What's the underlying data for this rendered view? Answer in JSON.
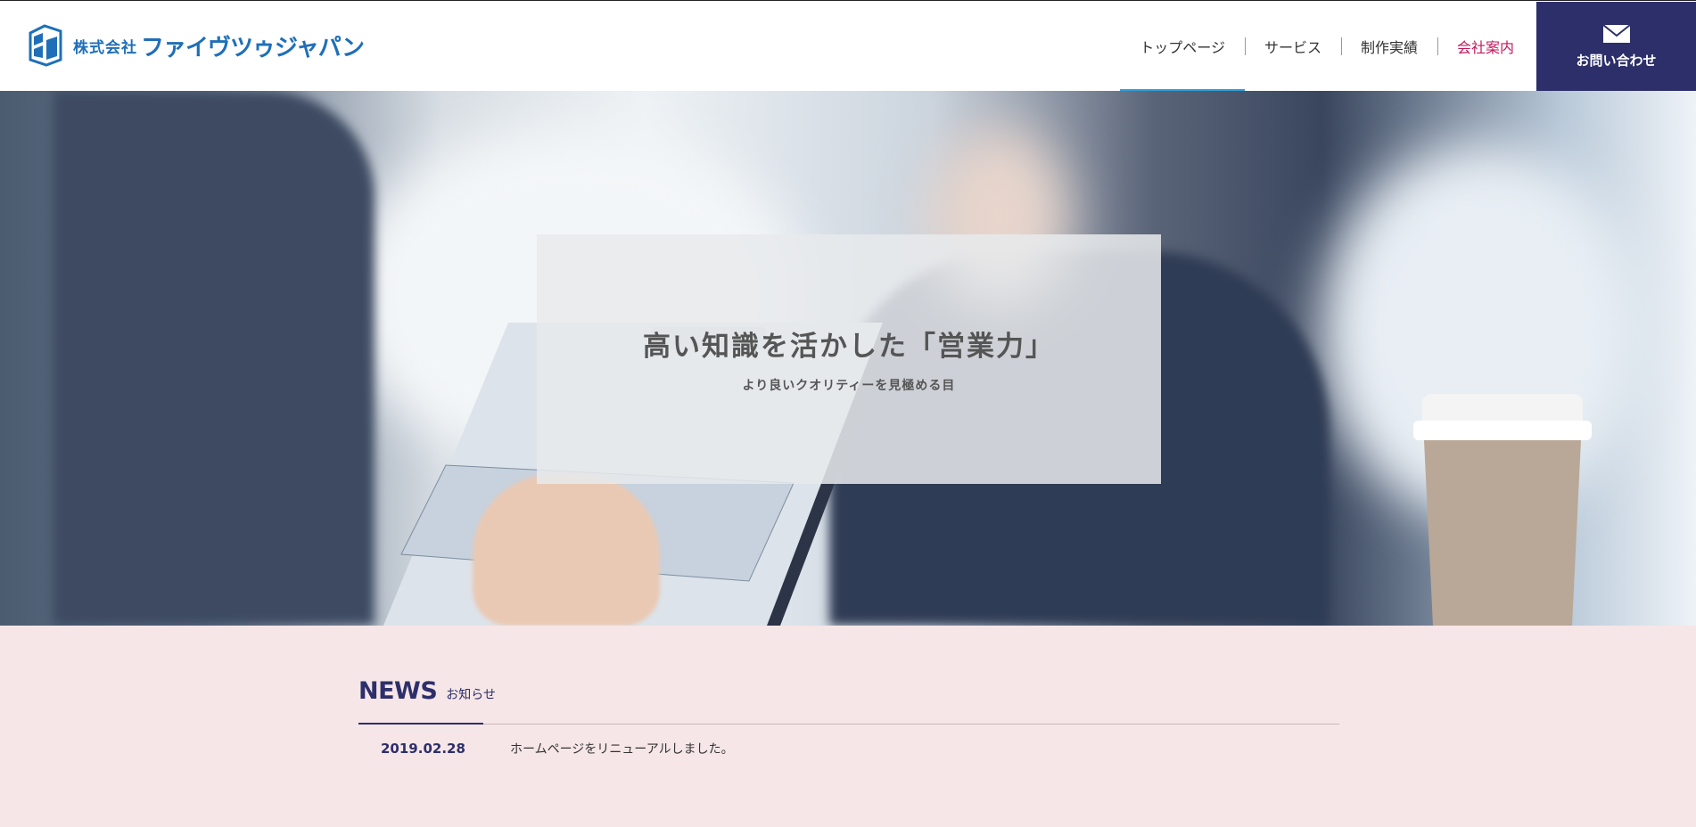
{
  "header": {
    "logo_small": "株式会社",
    "logo_big": "ファイヴツゥジャパン",
    "nav": [
      {
        "label": "トップページ"
      },
      {
        "label": "サービス"
      },
      {
        "label": "制作実績"
      },
      {
        "label": "会社案内"
      }
    ],
    "contact_label": "お問い合わせ"
  },
  "hero": {
    "title": "高い知識を活かした「営業力」",
    "subtitle": "より良いクオリティーを見極める目"
  },
  "news": {
    "title": "NEWS",
    "subtitle": "お知らせ",
    "items": [
      {
        "date": "2019.02.28",
        "text": "ホームページをリニューアルしました。"
      }
    ]
  },
  "colors": {
    "brand_navy": "#2d2f6a",
    "logo_blue": "#1f6fb8",
    "nav_active_underline": "#2e9fd6",
    "nav_highlight": "#c2185b",
    "news_bg": "#f6e6e7"
  },
  "icons": {
    "logo": "company-logo-mark",
    "contact": "envelope-icon"
  }
}
